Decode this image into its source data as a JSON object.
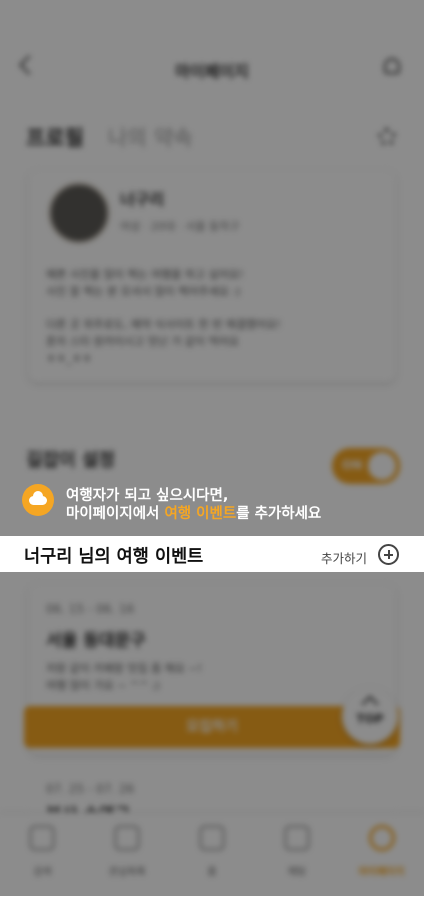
{
  "header": {
    "title": "마이페이지"
  },
  "tabs": {
    "profile": "프로필",
    "intro": "나의 약속"
  },
  "profile": {
    "nickname": "너구리",
    "meta": "여성 · 20대 · 서울 동작구",
    "intro_1": "예쁜 사진을 많이 찍는 여행을 하고 싶어요!",
    "intro_2": "사진 잘 찍는 분 모셔서 많이 찍어주세요 :)",
    "intro_3": "다른 곳 위주로도, 예약 식사이트 한 번 해결했어요!",
    "intro_4": "혼자 스타 원카이시고 맛난 거 같이 먹어요",
    "intro_5": "ㅎㅎ_ㅎㅎ"
  },
  "settings": {
    "guide_label": "길잡이 설정",
    "toggle_label": "ON"
  },
  "banner": {
    "line1": "여행자가 되고 싶으시다면,",
    "line2_before": "마이페이지에서 ",
    "line2_highlight": "여행 이벤트",
    "line2_after": "를 추가하세요"
  },
  "events_section": {
    "title": "너구리 님의 여행 이벤트",
    "add_label": "추가하기"
  },
  "event": {
    "date": "06. 15 - 06. 16",
    "title": "서울 동대문구",
    "desc_1": "저랑 같이 카페랑 맛집 좀 해요 ~!",
    "desc_2": "여행 많이 가요 ~ ^^ ;)",
    "button": "모집하기"
  },
  "event2": {
    "date": "07. 25 - 07. 26",
    "title": "부산 수영구"
  },
  "top_button": "TOP",
  "nav": [
    {
      "label": "검색"
    },
    {
      "label": "관심목록"
    },
    {
      "label": "홈"
    },
    {
      "label": "채팅"
    },
    {
      "label": "마이페이지"
    }
  ],
  "colors": {
    "accent": "#f5a623"
  },
  "icons": [
    "back-icon",
    "bell-icon",
    "gear-icon",
    "cloud-icon",
    "plus-circle-icon",
    "chevron-up-icon"
  ]
}
